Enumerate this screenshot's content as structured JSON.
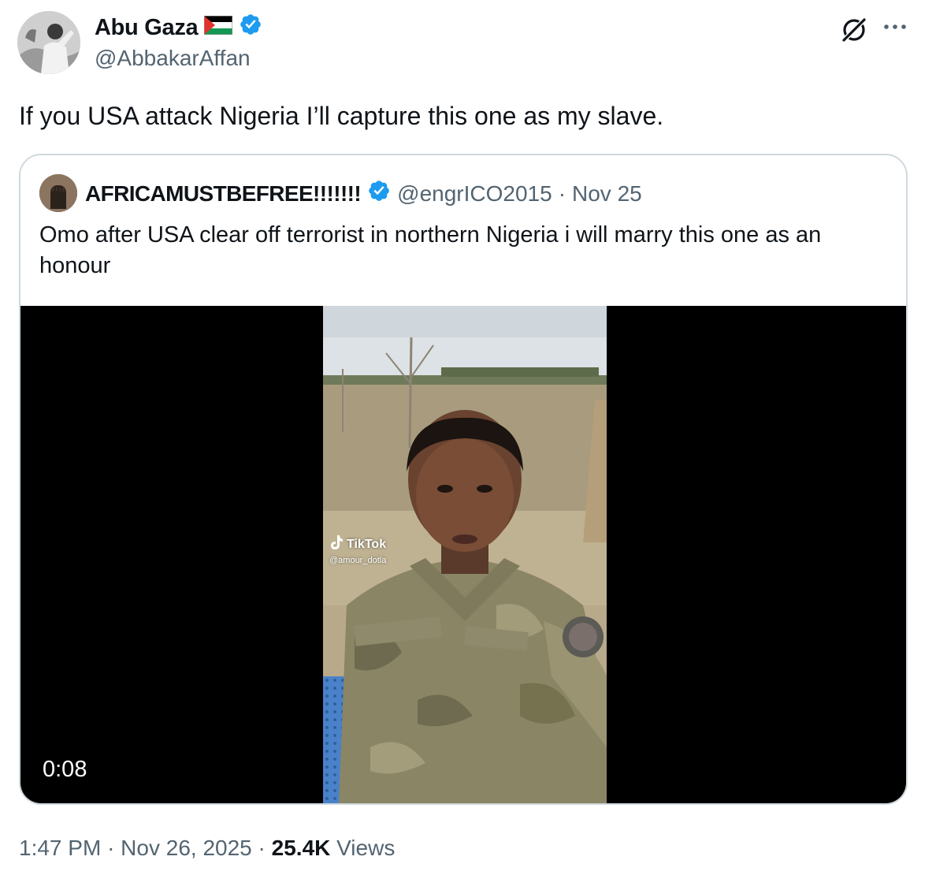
{
  "author": {
    "name": "Abu Gaza",
    "handle": "@AbbakarAffan",
    "verified": true
  },
  "icons": {
    "flag": "palestine-flag-icon",
    "verified": "verified-badge-icon",
    "grok": "grok-icon",
    "more": "more-options-icon",
    "tiktok": "tiktok-logo-icon"
  },
  "tweet": {
    "text": "If you USA attack Nigeria I’ll capture this one as my slave."
  },
  "quoted": {
    "name": "AFRICAMUSTBEFREE!!!!!!!",
    "handle": "@engrICO2015",
    "separator": "·",
    "date": "Nov 25",
    "text": "Omo after USA clear off terrorist in northern Nigeria i will marry this one as an honour",
    "video": {
      "duration": "0:08",
      "watermark_brand": "TikTok",
      "watermark_user": "@amour_dotla"
    }
  },
  "meta": {
    "time": "1:47 PM",
    "separator": "·",
    "date": "Nov 26, 2025",
    "views_count": "25.4K",
    "views_label": "Views"
  },
  "colors": {
    "text_primary": "#0f1419",
    "text_secondary": "#536471",
    "verified_blue": "#1d9bf0",
    "border": "#cfd9de"
  }
}
